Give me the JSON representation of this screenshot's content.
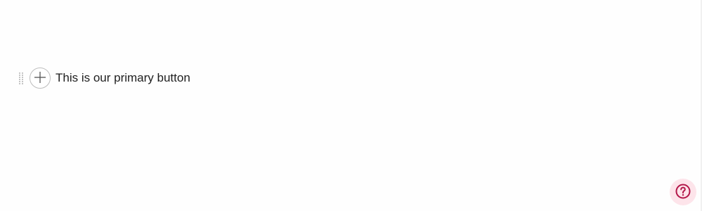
{
  "editor": {
    "block_text": "This is our primary button",
    "drag_handle_icon": "drag-handle-icon",
    "add_block_icon": "plus-icon"
  },
  "help": {
    "icon": "question-mark-icon",
    "accent_color": "#b3174a",
    "background_color": "#fde4ea"
  }
}
